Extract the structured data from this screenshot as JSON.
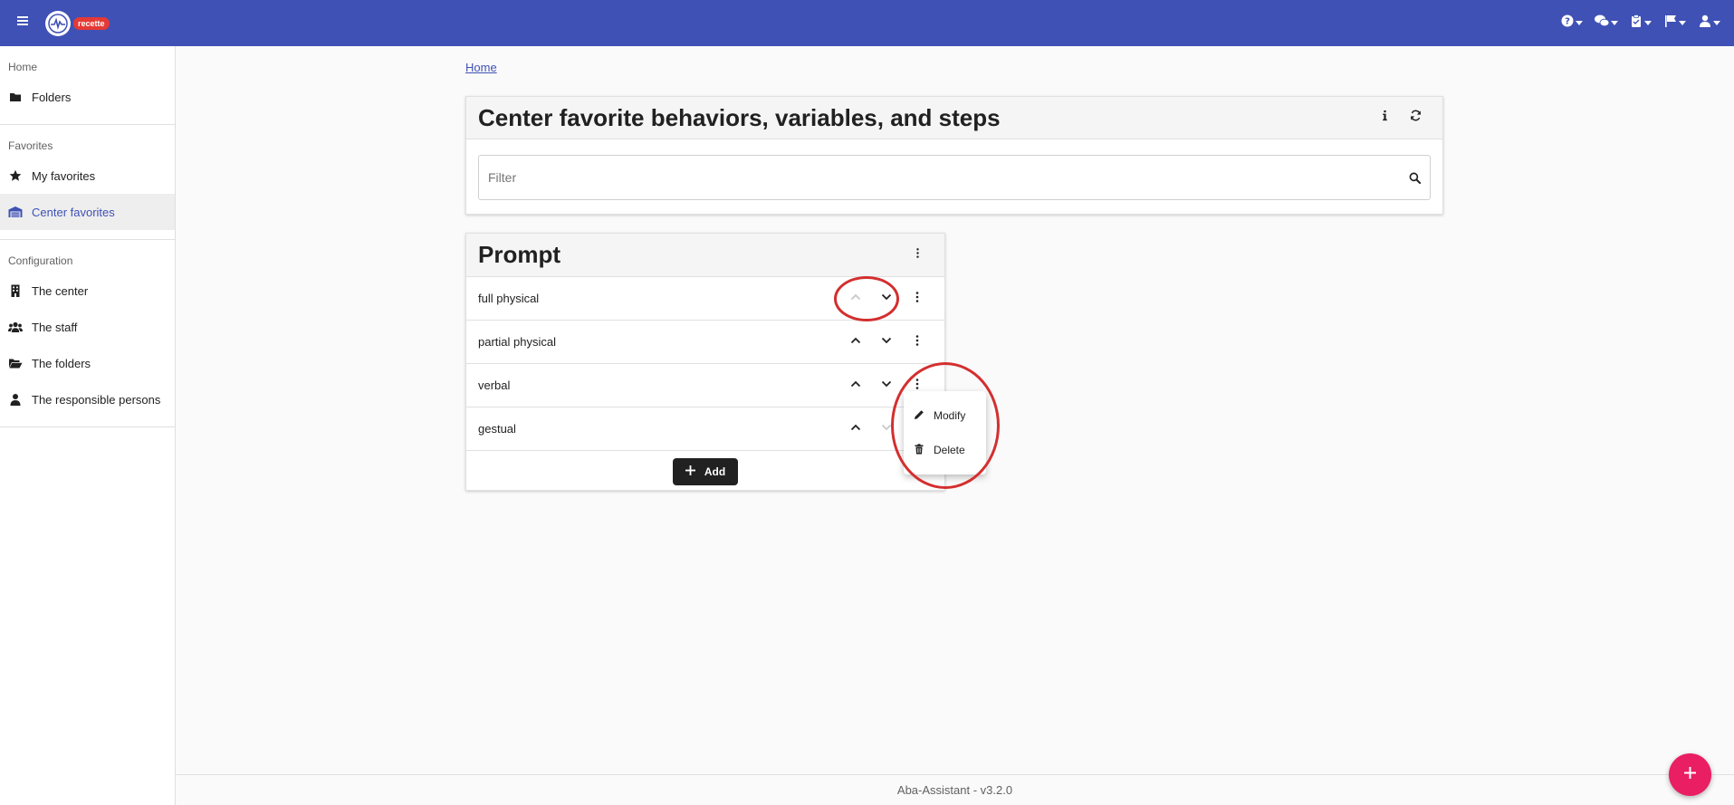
{
  "topbar": {
    "env_badge": "recette",
    "icons": [
      "menu-icon",
      "help-icon",
      "chat-icon",
      "clipboard-icon",
      "flag-icon",
      "user-icon"
    ],
    "color": "#3f51b5"
  },
  "sidebar": {
    "sections": [
      {
        "heading": "Home",
        "items": [
          {
            "label": "Folders",
            "icon": "folder-icon"
          }
        ]
      },
      {
        "heading": "Favorites",
        "items": [
          {
            "label": "My favorites",
            "icon": "star-icon"
          },
          {
            "label": "Center favorites",
            "icon": "warehouse-icon",
            "active": true
          }
        ]
      },
      {
        "heading": "Configuration",
        "items": [
          {
            "label": "The center",
            "icon": "building-icon"
          },
          {
            "label": "The staff",
            "icon": "users-icon"
          },
          {
            "label": "The folders",
            "icon": "folder-open-icon"
          },
          {
            "label": "The responsible persons",
            "icon": "person-icon"
          }
        ]
      }
    ]
  },
  "breadcrumb": {
    "home": "Home"
  },
  "main_card": {
    "title": "Center favorite behaviors, variables, and steps",
    "filter_placeholder": "Filter"
  },
  "prompt_card": {
    "title": "Prompt",
    "rows": [
      {
        "label": "full physical"
      },
      {
        "label": "partial physical"
      },
      {
        "label": "verbal"
      },
      {
        "label": "gestual"
      }
    ],
    "add_label": "Add"
  },
  "context_menu": {
    "modify": "Modify",
    "delete": "Delete"
  },
  "footer": {
    "version": "Aba-Assistant - v3.2.0"
  },
  "colors": {
    "accent": "#3f51b5",
    "fab": "#e91e63",
    "annotation": "#d32f2f"
  }
}
